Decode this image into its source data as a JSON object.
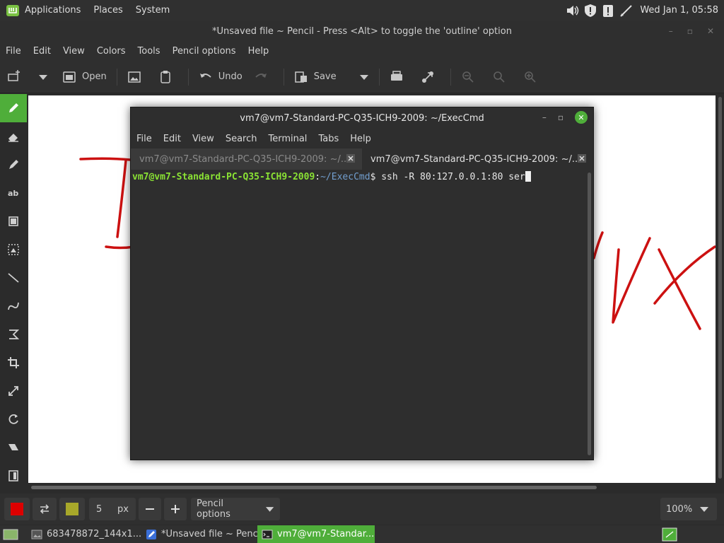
{
  "top_panel": {
    "menus": [
      "Applications",
      "Places",
      "System"
    ],
    "clock": "Wed Jan  1, 05:58"
  },
  "app": {
    "title": "*Unsaved file ~ Pencil - Press <Alt> to toggle the 'outline' option",
    "menus": [
      "File",
      "Edit",
      "View",
      "Colors",
      "Tools",
      "Pencil options",
      "Help"
    ],
    "toolbar": {
      "open_label": "Open",
      "undo_label": "Undo",
      "save_label": "Save"
    },
    "tools": [
      "pencil",
      "eraser",
      "highlighter",
      "text",
      "rectangle-select",
      "free-select",
      "line",
      "curve",
      "shape",
      "crop",
      "scale",
      "rotate",
      "skew",
      "filters"
    ],
    "bottom": {
      "primary_color": "#dd0000",
      "secondary_color": "#a8a82a",
      "size_value": "5",
      "size_unit": "px",
      "options_label": "Pencil options",
      "zoom": "100%"
    },
    "drawing_color": "#cc1111"
  },
  "terminal": {
    "title": "vm7@vm7-Standard-PC-Q35-ICH9-2009: ~/ExecCmd",
    "menus": [
      "File",
      "Edit",
      "View",
      "Search",
      "Terminal",
      "Tabs",
      "Help"
    ],
    "tabs": [
      {
        "label": "vm7@vm7-Standard-PC-Q35-ICH9-2009: ~/...",
        "active": false
      },
      {
        "label": "vm7@vm7-Standard-PC-Q35-ICH9-2009: ~/...",
        "active": true
      }
    ],
    "prompt_user": "vm7@vm7-Standard-PC-Q35-ICH9-2009",
    "prompt_sep": ":",
    "prompt_path": "~/ExecCmd",
    "prompt_end": "$ ",
    "command": "ssh -R 80:127.0.0.1:80 ser"
  },
  "taskbar": {
    "items": [
      {
        "label": "683478872_144x1...",
        "active": false
      },
      {
        "label": "*Unsaved file ~ Penc...",
        "active": false
      },
      {
        "label": "vm7@vm7-Standar...",
        "active": true
      }
    ]
  }
}
